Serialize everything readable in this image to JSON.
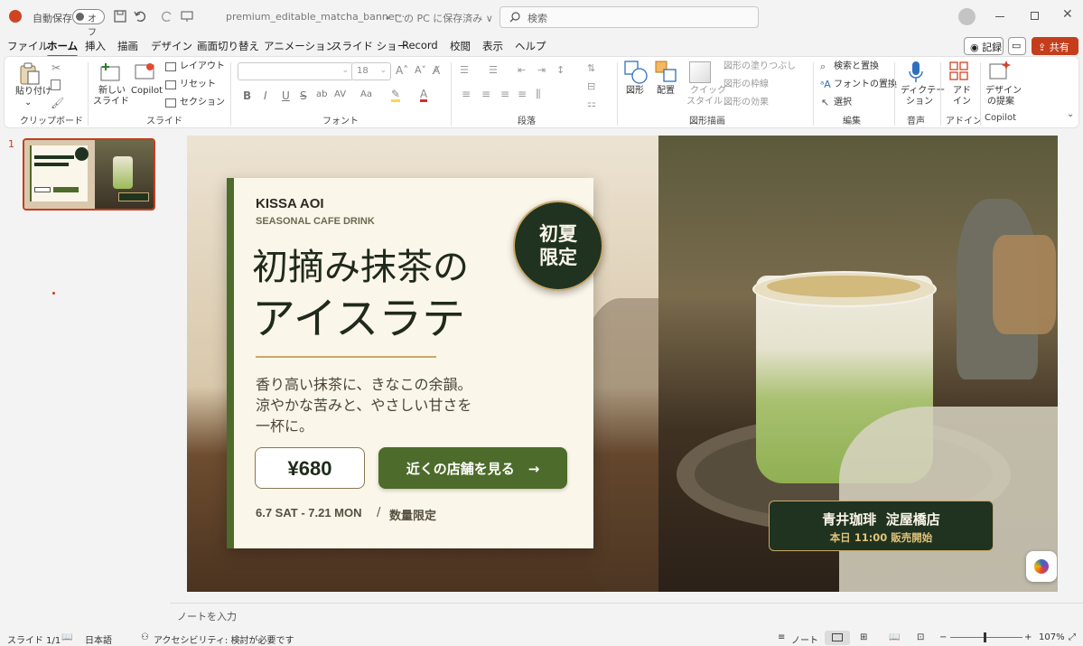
{
  "titlebar": {
    "autosave_label": "自動保存",
    "autosave_state": "オフ",
    "file_name": "premium_editable_matcha_banner···",
    "save_location": "• この PC に保存済み ∨",
    "search_placeholder": "検索"
  },
  "menu": {
    "tabs": [
      "ファイル",
      "ホーム",
      "挿入",
      "描画",
      "デザイン",
      "画面切り替え",
      "アニメーション",
      "スライド ショー",
      "Record",
      "校閲",
      "表示",
      "ヘルプ"
    ],
    "record_button": "記録",
    "share_button": "共有"
  },
  "ribbon": {
    "clipboard": {
      "paste": "貼り付け",
      "label": "クリップボード"
    },
    "slides": {
      "new_slide_line1": "新しい",
      "new_slide_line2": "スライド",
      "copilot": "Copilot",
      "layout": "レイアウト",
      "reset": "リセット",
      "section": "セクション",
      "label": "スライド"
    },
    "font": {
      "size": "18",
      "label": "フォント",
      "bold": "B",
      "italic": "I",
      "underline": "U",
      "strike": "S",
      "shadow": "ab",
      "spacing": "AV",
      "case": "Aa"
    },
    "paragraph": {
      "label": "段落"
    },
    "drawing": {
      "shapes": "図形",
      "arrange": "配置",
      "quick_style_line1": "クイック",
      "quick_style_line2": "スタイル",
      "fill": "図形の塗りつぶし",
      "outline": "図形の枠線",
      "effects": "図形の効果",
      "label": "図形描画"
    },
    "editing": {
      "find": "検索と置換",
      "replace_font": "フォントの置換",
      "select": "選択",
      "label": "編集"
    },
    "voice": {
      "dictation_line1": "ディクテー",
      "dictation_line2": "ション",
      "label": "音声"
    },
    "addins": {
      "addin_line1": "アド",
      "addin_line2": "イン",
      "label": "アドイン"
    },
    "copilot": {
      "design_line1": "デザイン",
      "design_line2": "の提案",
      "label": "Copilot"
    }
  },
  "thumbnails": [
    {
      "number": "1"
    }
  ],
  "slide": {
    "brand": "KISSA AOI",
    "subtitle": "SEASONAL CAFE DRINK",
    "title_line1": "初摘み抹茶の",
    "title_line2": "アイスラテ",
    "desc_line1": "香り高い抹茶に、きなこの余韻。",
    "desc_line2": "涼やかな苦みと、やさしい甘さを",
    "desc_line3": "一杯に。",
    "price": "¥680",
    "cta": "近くの店舗を見る　→",
    "dates": "6.7 SAT - 7.21 MON",
    "slash": "/",
    "limited": "数量限定",
    "badge_line1": "初夏",
    "badge_line2": "限定",
    "store_name": "青井珈琲  淀屋橋店",
    "store_open": "本日 11:00 販売開始",
    "colors": {
      "accent_green": "#4d6b2a",
      "dark_green": "#1f3320",
      "cream": "#fbf6ea",
      "gold": "#c9a86a"
    }
  },
  "notes_placeholder": "ノートを入力",
  "status": {
    "slide_pos": "スライド 1/1",
    "language": "日本語",
    "accessibility": "アクセシビリティ: 検討が必要です",
    "notes": "ノート",
    "zoom": "107%"
  }
}
